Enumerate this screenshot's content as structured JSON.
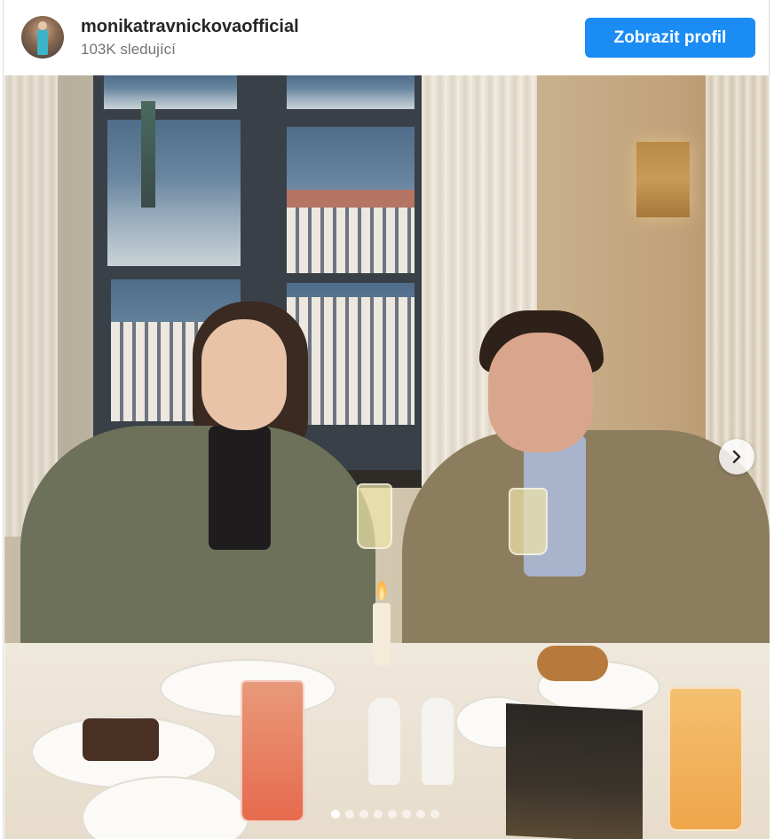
{
  "profile": {
    "username": "monikatravnickova​official",
    "followers": "103K sledující",
    "view_profile_label": "Zobrazit profil"
  },
  "carousel": {
    "slide_count": 8,
    "active_index": 0,
    "next_icon": "chevron-right-icon"
  },
  "colors": {
    "button": "#1a8cf4",
    "username": "#262626",
    "followers": "#737373"
  }
}
